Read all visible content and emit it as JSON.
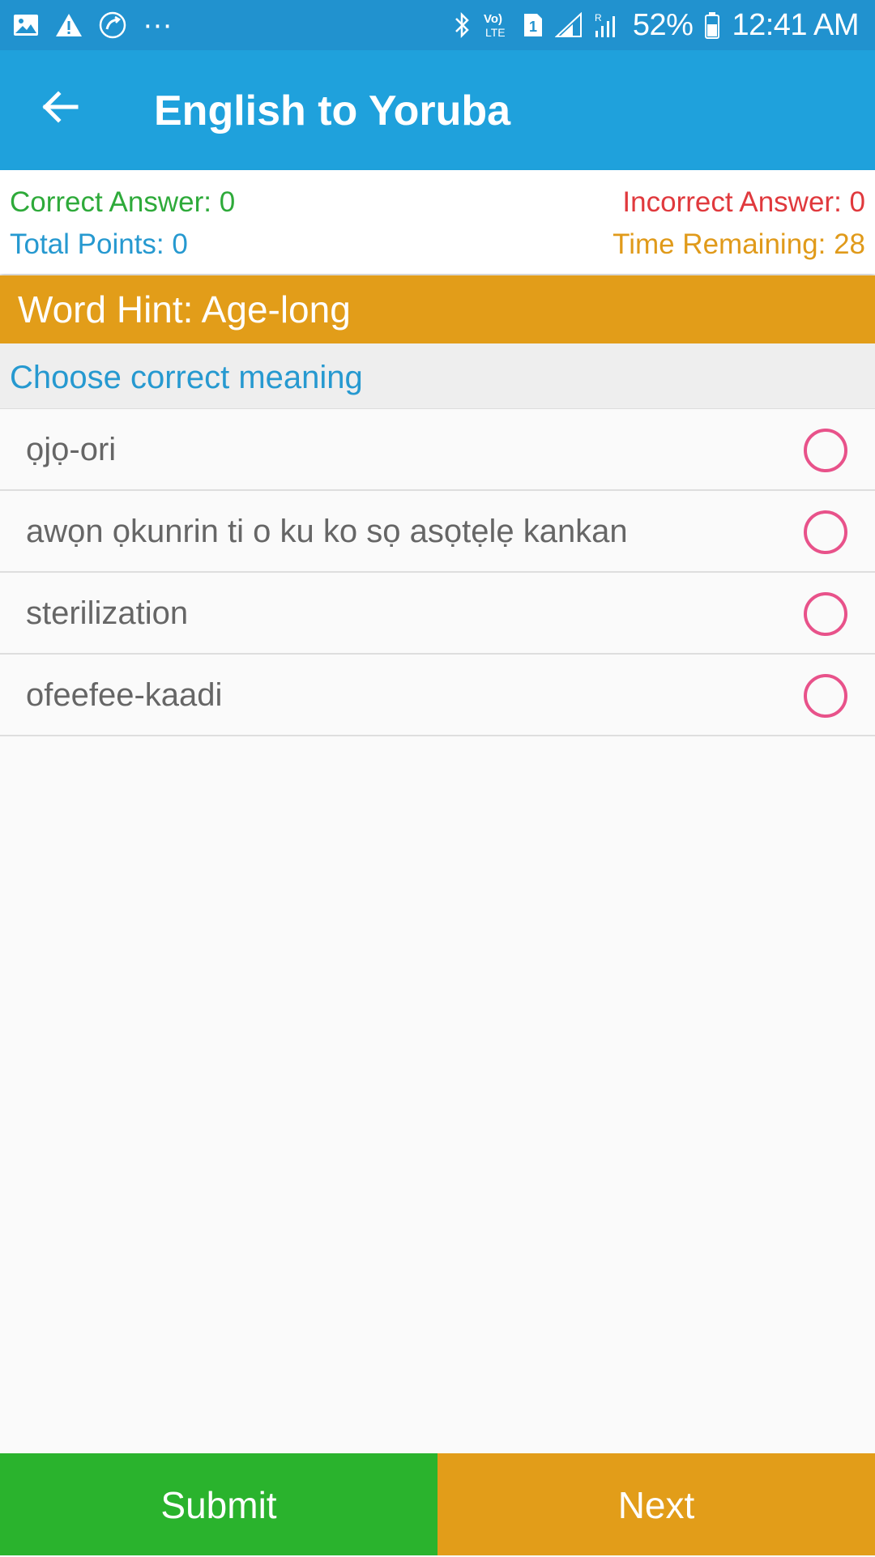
{
  "status_bar": {
    "battery_percent": "52%",
    "time": "12:41 AM",
    "overflow": "···",
    "volte_label_top": "Vo)",
    "volte_label_bottom": "LTE",
    "sim_label": "1",
    "roaming_label": "R"
  },
  "app_bar": {
    "title": "English to Yoruba",
    "back_icon": "arrow-left-icon",
    "background": "#1fa1dc"
  },
  "stats": {
    "correct": "Correct Answer: 0",
    "incorrect": "Incorrect Answer: 0",
    "points": "Total Points: 0",
    "time_remaining": "Time Remaining: 28"
  },
  "hint": {
    "text": "Word Hint: Age-long"
  },
  "instruction": {
    "text": "Choose correct meaning"
  },
  "options": [
    {
      "label": "ọjọ-ori",
      "selected": false
    },
    {
      "label": "awọn ọkunrin ti o ku ko sọ asọtẹlẹ kankan",
      "selected": false
    },
    {
      "label": "sterilization",
      "selected": false
    },
    {
      "label": "ofeefee-kaadi",
      "selected": false
    }
  ],
  "buttons": {
    "submit": "Submit",
    "next": "Next"
  },
  "colors": {
    "correct": "#2eaa3a",
    "incorrect": "#e0393d",
    "points": "#2699d0",
    "time": "#e09a1a",
    "hint_bg": "#e29d19",
    "radio": "#e8528a",
    "submit_bg": "#2ab32d",
    "next_bg": "#e29d19"
  }
}
